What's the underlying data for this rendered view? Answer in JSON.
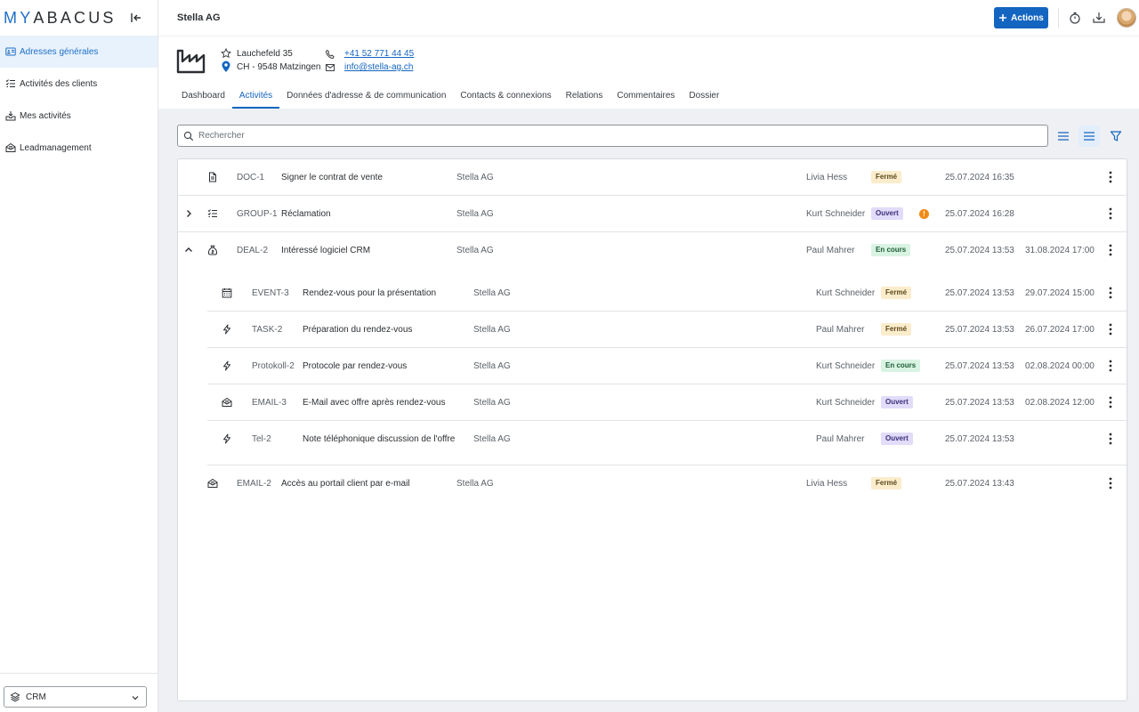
{
  "app": {
    "logo_prefix": "MY",
    "logo_rest": "ABACUS"
  },
  "sidebar": {
    "items": [
      {
        "label": "Adresses générales",
        "icon": "address-card-icon",
        "active": true
      },
      {
        "label": "Activités des clients",
        "icon": "checklist-icon",
        "active": false
      },
      {
        "label": "Mes activités",
        "icon": "inbox-tray-icon",
        "active": false
      },
      {
        "label": "Leadmanagement",
        "icon": "mail-open-icon",
        "active": false
      }
    ],
    "module_select": {
      "value": "CRM",
      "icon": "layers-icon"
    }
  },
  "header": {
    "title": "Stella AG",
    "actions_label": "Actions"
  },
  "company": {
    "street": "Lauchefeld 35",
    "city": "CH - 9548 Matzingen",
    "phone": "+41 52 771 44 45",
    "email": "info@stella-ag.ch"
  },
  "tabs": [
    {
      "label": "Dashboard",
      "active": false
    },
    {
      "label": "Activités",
      "active": true
    },
    {
      "label": "Données d'adresse & de communication",
      "active": false
    },
    {
      "label": "Contacts & connexions",
      "active": false
    },
    {
      "label": "Relations",
      "active": false
    },
    {
      "label": "Commentaires",
      "active": false
    },
    {
      "label": "Dossier",
      "active": false
    }
  ],
  "search": {
    "placeholder": "Rechercher"
  },
  "activities": [
    {
      "id": "DOC-1",
      "title": "Signer le contrat de vente",
      "company": "Stella AG",
      "person": "Livia Hess",
      "status": "Fermé",
      "start": "25.07.2024 16:35",
      "end": "",
      "icon": "document-icon",
      "expander": "none",
      "level": 0,
      "warning": false
    },
    {
      "id": "GROUP-1",
      "title": "Réclamation",
      "company": "Stella AG",
      "person": "Kurt Schneider",
      "status": "Ouvert",
      "start": "25.07.2024 16:28",
      "end": "",
      "icon": "checklist-icon",
      "expander": "collapsed",
      "level": 0,
      "warning": true,
      "warning_symbol": "!"
    },
    {
      "id": "DEAL-2",
      "title": "Intéressé logiciel CRM",
      "company": "Stella AG",
      "person": "Paul Mahrer",
      "status": "En cours",
      "start": "25.07.2024 13:53",
      "end": "31.08.2024 17:00",
      "icon": "money-bag-icon",
      "expander": "expanded",
      "level": 0,
      "warning": false
    },
    {
      "id": "EVENT-3",
      "title": "Rendez-vous pour la présentation",
      "company": "Stella AG",
      "person": "Kurt Schneider",
      "status": "Fermé",
      "start": "25.07.2024 13:53",
      "end": "29.07.2024 15:00",
      "icon": "calendar-icon",
      "expander": "none",
      "level": 1,
      "warning": false
    },
    {
      "id": "TASK-2",
      "title": "Préparation du rendez-vous",
      "company": "Stella AG",
      "person": "Paul Mahrer",
      "status": "Fermé",
      "start": "25.07.2024 13:53",
      "end": "26.07.2024 17:00",
      "icon": "lightning-icon",
      "expander": "none",
      "level": 1,
      "warning": false
    },
    {
      "id": "Protokoll-2",
      "title": "Protocole par rendez-vous",
      "company": "Stella AG",
      "person": "Kurt Schneider",
      "status": "En cours",
      "start": "25.07.2024 13:53",
      "end": "02.08.2024 00:00",
      "icon": "lightning-icon",
      "expander": "none",
      "level": 1,
      "warning": false
    },
    {
      "id": "EMAIL-3",
      "title": "E-Mail avec offre après rendez-vous",
      "company": "Stella AG",
      "person": "Kurt Schneider",
      "status": "Ouvert",
      "start": "25.07.2024 13:53",
      "end": "02.08.2024 12:00",
      "icon": "mail-open-icon",
      "expander": "none",
      "level": 1,
      "warning": false
    },
    {
      "id": "Tel-2",
      "title": "Note téléphonique discussion de l'offre",
      "company": "Stella AG",
      "person": "Paul Mahrer",
      "status": "Ouvert",
      "start": "25.07.2024 13:53",
      "end": "",
      "icon": "lightning-icon",
      "expander": "none",
      "level": 1,
      "warning": false
    },
    {
      "id": "EMAIL-2",
      "title": "Accès au portail client par e-mail",
      "company": "Stella AG",
      "person": "Livia Hess",
      "status": "Fermé",
      "start": "25.07.2024 13:43",
      "end": "",
      "icon": "mail-open-icon",
      "expander": "none",
      "level": 0,
      "warning": false
    }
  ],
  "colors": {
    "accent": "#1465c0",
    "nav_active_bg": "#e8f2fc",
    "warning": "#f08a17"
  }
}
